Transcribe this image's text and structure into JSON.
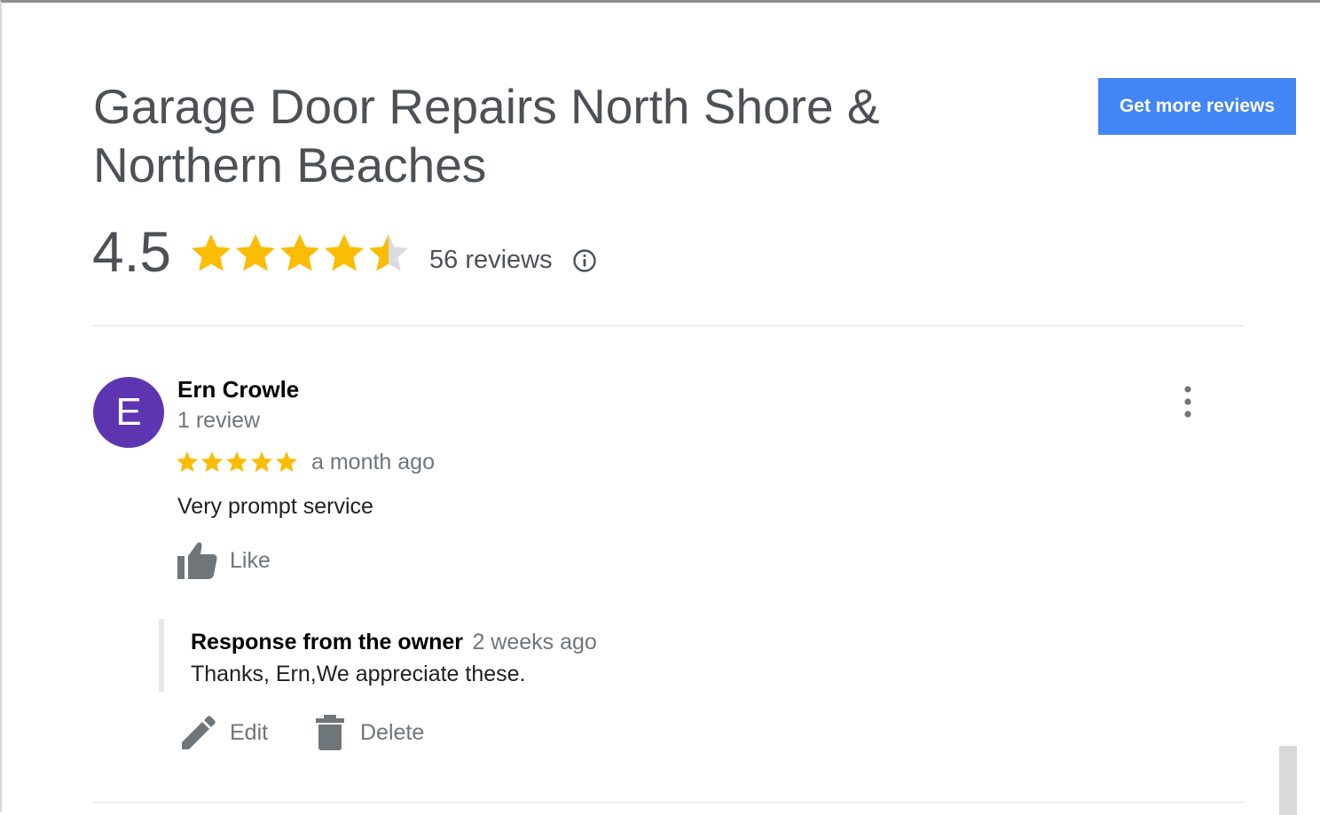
{
  "business": {
    "name": "Garage Door Repairs North Shore & Northern Beaches",
    "rating": "4.5",
    "rating_value": 4.5,
    "reviews_count_label": "56 reviews"
  },
  "header": {
    "cta_label": "Get more reviews"
  },
  "review": {
    "avatar_letter": "E",
    "reviewer_name": "Ern Crowle",
    "reviewer_sub": "1 review",
    "stars": 5,
    "time": "a month ago",
    "text": "Very prompt service",
    "like_label": "Like",
    "owner_reply": {
      "label": "Response from the owner",
      "time": "2 weeks ago",
      "text": "Thanks, Ern,We appreciate these."
    },
    "edit_label": "Edit",
    "delete_label": "Delete"
  },
  "colors": {
    "star": "#fbbc04",
    "star_empty": "#dadce0",
    "accent": "#4285f4",
    "avatar": "#5e35b1",
    "icon": "#70757a"
  },
  "icons": [
    "star-icon",
    "info-icon",
    "more-vert-icon",
    "thumb-up-icon",
    "pencil-icon",
    "trash-icon"
  ]
}
